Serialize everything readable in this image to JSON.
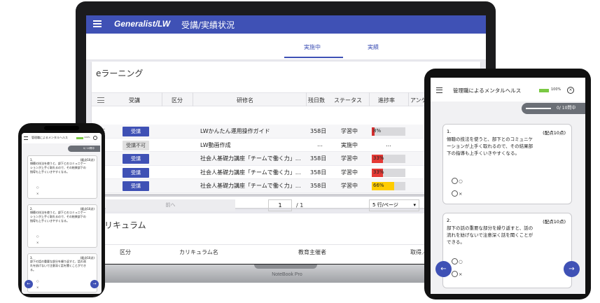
{
  "laptop": {
    "brand": "NoteBook Pro",
    "app": {
      "logo": "Generalist/LW",
      "page_title": "受講/実績状況",
      "tabs": [
        {
          "label": "実施中",
          "active": true
        },
        {
          "label": "実績",
          "active": false
        }
      ],
      "elearning": {
        "title": "eラーニング",
        "columns": [
          "受講",
          "区分",
          "研修名",
          "残日数",
          "ステータス",
          "進捗率",
          "アンケ"
        ],
        "rows": [
          {
            "button": "受講",
            "button_enabled": true,
            "name": "LWかんたん運用操作ガイド",
            "days": "358日",
            "status": "学習中",
            "progress": "8%",
            "progress_value": 8,
            "progress_color": "#d32f2f"
          },
          {
            "button": "受講不可",
            "button_enabled": false,
            "name": "LW動画作成",
            "days": "…",
            "status": "実施中",
            "progress": "…",
            "progress_value": null,
            "progress_color": ""
          },
          {
            "button": "受講",
            "button_enabled": true,
            "name": "社会人基礎力講座「チームで働く力」…",
            "days": "358日",
            "status": "学習中",
            "progress": "33%",
            "progress_value": 33,
            "progress_color": "#e53935"
          },
          {
            "button": "受講",
            "button_enabled": true,
            "name": "社会人基礎力講座「チームで働く力」…",
            "days": "358日",
            "status": "学習中",
            "progress": "33%",
            "progress_value": 33,
            "progress_color": "#e53935"
          },
          {
            "button": "受講",
            "button_enabled": true,
            "name": "社会人基礎力講座「チームで働く力」…",
            "days": "358日",
            "status": "学習中",
            "progress": "66%",
            "progress_value": 66,
            "progress_color": "#ffcc00"
          }
        ],
        "pager": {
          "prev_label": "前へ",
          "page": "1",
          "total": "/ 1",
          "per_page": "5 行/ページ"
        }
      },
      "curriculum": {
        "title": "カリキュラム",
        "columns": [
          "区分",
          "カリキュラム名",
          "教育主催者",
          "取得／必"
        ]
      }
    }
  },
  "phone": {
    "title": "管理職によるメンタルヘルス",
    "progress_pct": "100%",
    "progress_value": 100,
    "counter": "0/ 10問中",
    "questions": [
      {
        "number": "1.",
        "points": "(配点10点)",
        "text": "傾聴の技法を使うと、部下とのコミュニケーションが上手く取れるので、その結果部下の指導も上手くいきやすくなる。",
        "options": [
          "○",
          "×"
        ]
      },
      {
        "number": "2.",
        "points": "(配点10点)",
        "text": "傾聴の技法を使うと、部下とのコミュニケーションが上手く取れるので、その結果部下の指導も上手くいきやすくなる。",
        "options": [
          "○",
          "×"
        ]
      },
      {
        "number": "3.",
        "points": "(配点10点)",
        "text": "部下の話の重要な部分を繰り返すと、話の流れを妨げないで注意深く話を聞くことができる。",
        "options": [
          "○",
          "×"
        ]
      }
    ],
    "prev_icon": "←",
    "next_icon": "→"
  },
  "tablet": {
    "title": "管理職によるメンタルヘルス",
    "progress_pct": "100%",
    "progress_value": 100,
    "counter": "0/ 10問中",
    "questions": [
      {
        "number": "1.",
        "points": "(配点10点)",
        "text": "傾聴の技法を使うと、部下とのコミュニケーションが上手く取れるので、その結果部下の指導も上手くいきやすくなる。",
        "options": [
          "○",
          "×"
        ]
      },
      {
        "number": "2.",
        "points": "(配点10点)",
        "text": "部下の話の重要な部分を繰り返すと、話の流れを妨げないで注意深く話を聞くことができる。",
        "options": [
          "○",
          "×"
        ]
      }
    ],
    "prev_icon": "←",
    "next_icon": "→",
    "close_icon": "×"
  }
}
